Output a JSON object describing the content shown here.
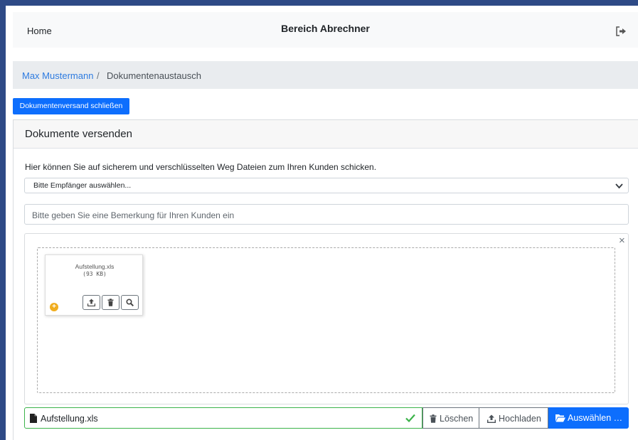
{
  "navbar": {
    "home_label": "Home",
    "title": "Bereich Abrechner",
    "logout_icon": "sign-out-icon"
  },
  "breadcrumb": {
    "parent": "Max Mustermann",
    "separator": "/",
    "current": "Dokumentenaustausch"
  },
  "actions": {
    "close_send_label": "Dokumentenversand schließen"
  },
  "card": {
    "title": "Dokumente versenden",
    "intro": "Hier können Sie auf sicherem und verschlüsselten Weg Dateien zum Ihren Kunden schicken.",
    "recipient_select": {
      "selected": "Bitte Empfänger auswählen..."
    },
    "remark_input": {
      "value": "",
      "placeholder": "Bitte geben Sie eine Bemerkung für Ihren Kunden ein"
    }
  },
  "upload": {
    "close_symbol": "×",
    "preview": {
      "file_name": "Aufstellung.xls",
      "file_size": "(93 KB)",
      "add_symbol": "+"
    },
    "file_caption": "Aufstellung.xls",
    "buttons": {
      "delete": "Löschen",
      "upload": "Hochladen",
      "browse": "Auswählen …"
    }
  },
  "colors": {
    "frame": "#2e4a86",
    "primary": "#0d6efd",
    "link": "#2d7be0",
    "success": "#3cb34a",
    "warning": "#f0ad1e"
  }
}
